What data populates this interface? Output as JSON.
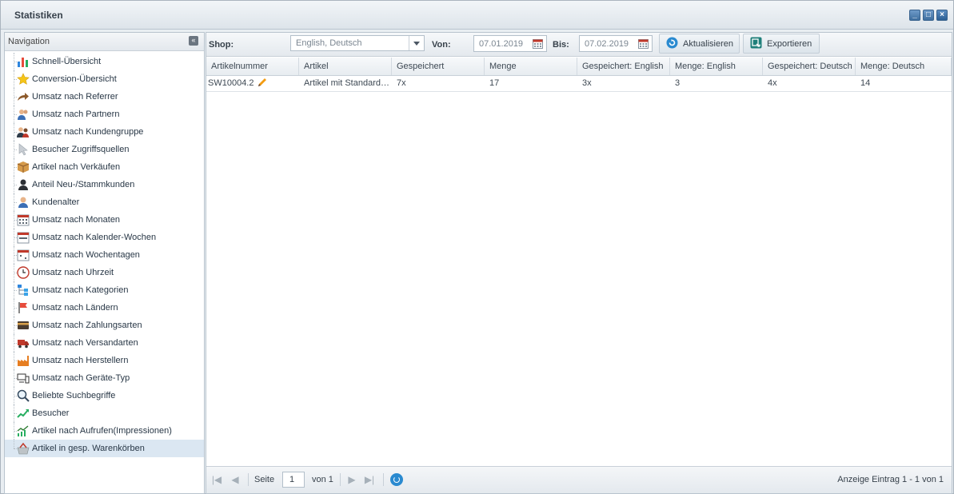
{
  "window": {
    "title": "Statistiken",
    "controls": [
      "minimize-icon",
      "maximize-icon",
      "close-icon"
    ]
  },
  "nav": {
    "title": "Navigation",
    "items": [
      {
        "label": "Schnell-Übersicht",
        "icon": "bar-chart-icon"
      },
      {
        "label": "Conversion-Übersicht",
        "icon": "star-icon"
      },
      {
        "label": "Umsatz nach Referrer",
        "icon": "arrow-share-icon"
      },
      {
        "label": "Umsatz nach Partnern",
        "icon": "user-pair-icon"
      },
      {
        "label": "Umsatz nach Kundengruppe",
        "icon": "users-group-icon"
      },
      {
        "label": "Besucher Zugriffsquellen",
        "icon": "cursor-icon"
      },
      {
        "label": "Artikel nach Verkäufen",
        "icon": "box-icon"
      },
      {
        "label": "Anteil Neu-/Stammkunden",
        "icon": "user-dark-icon"
      },
      {
        "label": "Kundenalter",
        "icon": "user-icon"
      },
      {
        "label": "Umsatz nach Monaten",
        "icon": "calendar-month-icon"
      },
      {
        "label": "Umsatz nach Kalender-Wochen",
        "icon": "calendar-week-icon"
      },
      {
        "label": "Umsatz nach Wochentagen",
        "icon": "calendar-day-icon"
      },
      {
        "label": "Umsatz nach Uhrzeit",
        "icon": "clock-icon"
      },
      {
        "label": "Umsatz nach Kategorien",
        "icon": "category-tree-icon"
      },
      {
        "label": "Umsatz nach Ländern",
        "icon": "flag-icon"
      },
      {
        "label": "Umsatz nach Zahlungsarten",
        "icon": "credit-card-icon"
      },
      {
        "label": "Umsatz nach Versandarten",
        "icon": "truck-icon"
      },
      {
        "label": "Umsatz nach Herstellern",
        "icon": "factory-icon"
      },
      {
        "label": "Umsatz nach Geräte-Typ",
        "icon": "devices-icon"
      },
      {
        "label": "Beliebte Suchbegriffe",
        "icon": "magnifier-icon"
      },
      {
        "label": "Besucher",
        "icon": "trend-up-icon"
      },
      {
        "label": "Artikel nach Aufrufen(Impressionen)",
        "icon": "chart-trend-icon"
      },
      {
        "label": "Artikel in gesp. Warenkörben",
        "icon": "basket-icon"
      }
    ],
    "selected_index": 22
  },
  "toolbar": {
    "shop_label": "Shop:",
    "shop_value": "English, Deutsch",
    "from_label": "Von:",
    "from_value": "07.01.2019",
    "to_label": "Bis:",
    "to_value": "07.02.2019",
    "refresh_label": "Aktualisieren",
    "export_label": "Exportieren"
  },
  "grid": {
    "columns": [
      "Artikelnummer",
      "Artikel",
      "Gespeichert",
      "Menge",
      "Gespeichert: English",
      "Menge: English",
      "Gespeichert: Deutsch",
      "Menge: Deutsch"
    ],
    "rows": [
      [
        "SW10004.2",
        "Artikel mit Standardkonfigurator",
        "7x",
        "17",
        "3x",
        "3",
        "4x",
        "14"
      ]
    ]
  },
  "pager": {
    "page_label": "Seite",
    "page_value": "1",
    "of_label": "von 1",
    "info": "Anzeige Eintrag 1 - 1 von 1"
  }
}
